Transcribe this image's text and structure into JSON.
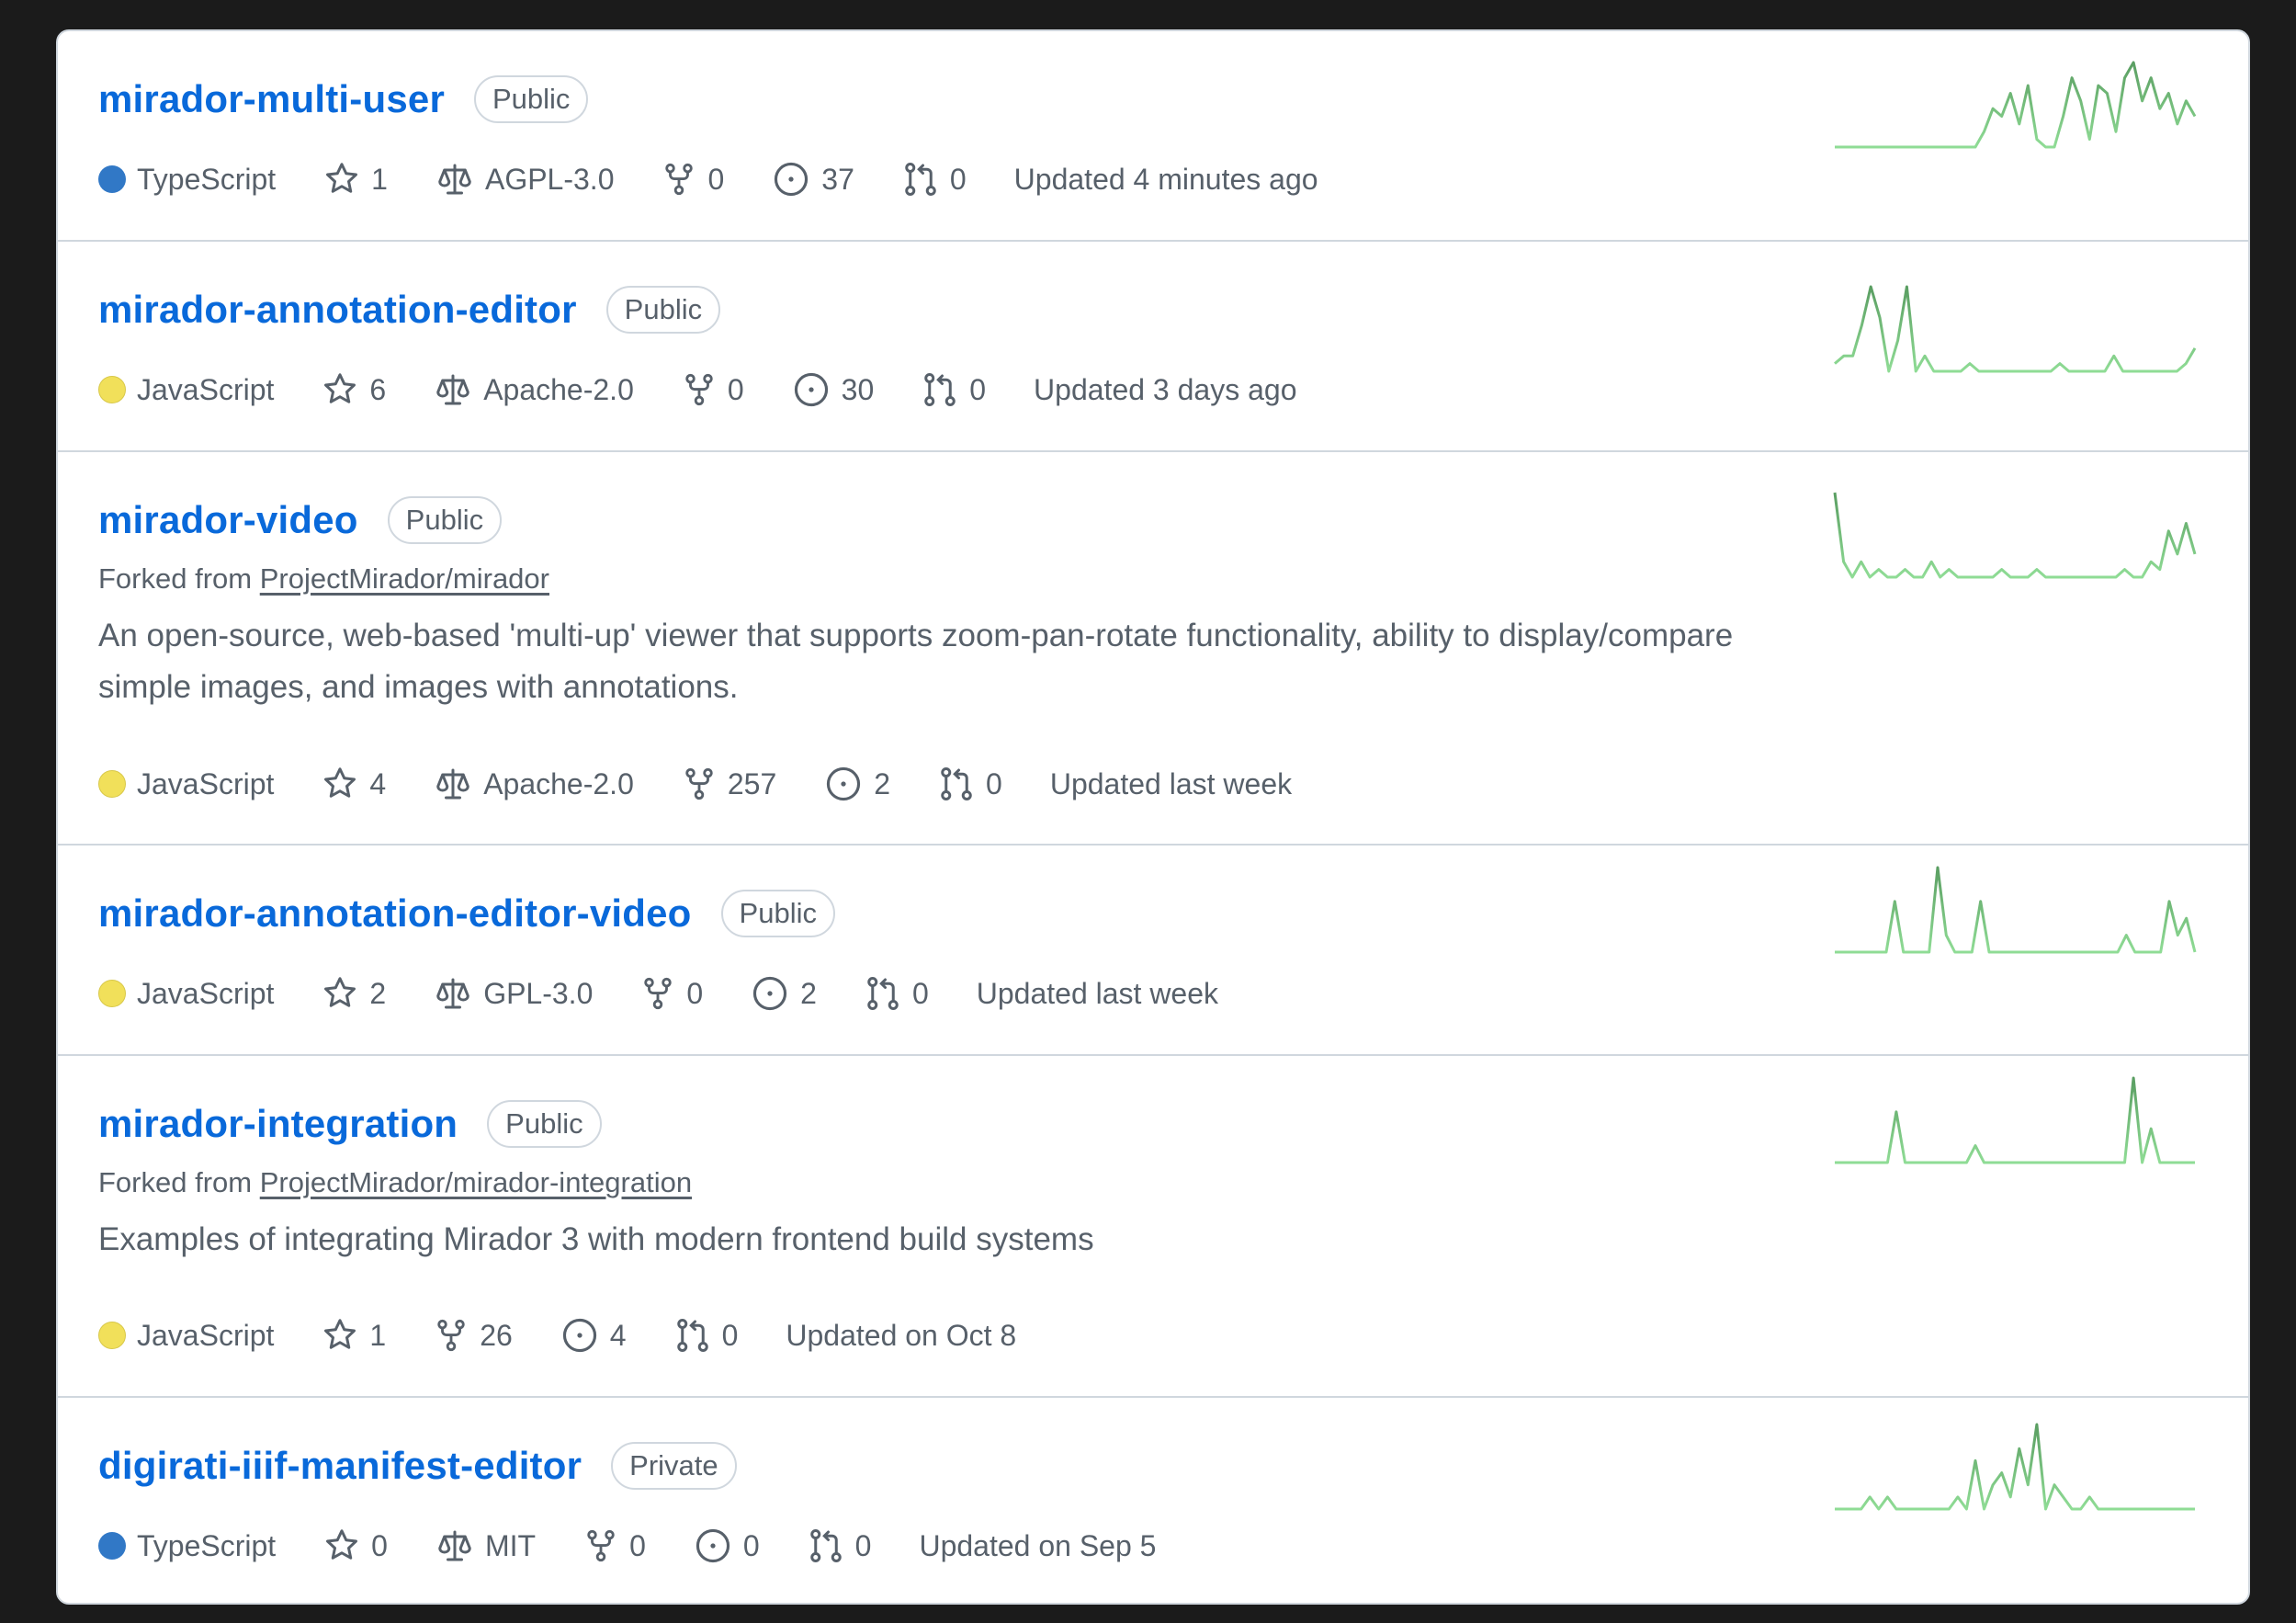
{
  "colors": {
    "link": "#0969da",
    "muted": "#57606a",
    "border": "#d0d7de",
    "typescript": "#3178c6",
    "javascript": "#f1e05a",
    "spark_light": "#8fdc95",
    "spark_dark": "#5a9e62"
  },
  "icons": [
    "star-icon",
    "law-icon",
    "fork-icon",
    "issue-icon",
    "pull-request-icon"
  ],
  "repos": [
    {
      "name": "mirador-multi-user",
      "visibility": "Public",
      "language": "TypeScript",
      "stars": "1",
      "license": "AGPL-3.0",
      "forks": "0",
      "issues": "37",
      "pulls": "0",
      "updated": "Updated 4 minutes ago",
      "activity": [
        0,
        0,
        0,
        0,
        0,
        0,
        0,
        0,
        0,
        0,
        0,
        0,
        0,
        0,
        0,
        0,
        0,
        2,
        5,
        4,
        7,
        3,
        8,
        1,
        0,
        0,
        4,
        9,
        6,
        1,
        8,
        7,
        2,
        9,
        11,
        6,
        9,
        5,
        7,
        3,
        6,
        4
      ]
    },
    {
      "name": "mirador-annotation-editor",
      "visibility": "Public",
      "language": "JavaScript",
      "stars": "6",
      "license": "Apache-2.0",
      "forks": "0",
      "issues": "30",
      "pulls": "0",
      "updated": "Updated 3 days ago",
      "activity": [
        1,
        2,
        2,
        6,
        11,
        7,
        0,
        4,
        11,
        0,
        2,
        0,
        0,
        0,
        0,
        1,
        0,
        0,
        0,
        0,
        0,
        0,
        0,
        0,
        0,
        1,
        0,
        0,
        0,
        0,
        0,
        2,
        0,
        0,
        0,
        0,
        0,
        0,
        0,
        1,
        3
      ]
    },
    {
      "name": "mirador-video",
      "visibility": "Public",
      "forked_prefix": "Forked from",
      "forked_from": "ProjectMirador/mirador",
      "description": "An open-source, web-based 'multi-up' viewer that supports zoom-pan-rotate functionality, ability to display/compare simple images, and images with annotations.",
      "language": "JavaScript",
      "stars": "4",
      "license": "Apache-2.0",
      "forks": "257",
      "issues": "2",
      "pulls": "0",
      "updated": "Updated last week",
      "activity": [
        11,
        2,
        0,
        2,
        0,
        1,
        0,
        0,
        1,
        0,
        0,
        2,
        0,
        1,
        0,
        0,
        0,
        0,
        0,
        1,
        0,
        0,
        0,
        1,
        0,
        0,
        0,
        0,
        0,
        0,
        0,
        0,
        0,
        1,
        0,
        0,
        2,
        1,
        6,
        3,
        7,
        3
      ]
    },
    {
      "name": "mirador-annotation-editor-video",
      "visibility": "Public",
      "language": "JavaScript",
      "stars": "2",
      "license": "GPL-3.0",
      "forks": "0",
      "issues": "2",
      "pulls": "0",
      "updated": "Updated last week",
      "activity": [
        0,
        0,
        0,
        0,
        0,
        0,
        0,
        3,
        0,
        0,
        0,
        0,
        5,
        1,
        0,
        0,
        0,
        3,
        0,
        0,
        0,
        0,
        0,
        0,
        0,
        0,
        0,
        0,
        0,
        0,
        0,
        0,
        0,
        0,
        1,
        0,
        0,
        0,
        0,
        3,
        1,
        2,
        0
      ]
    },
    {
      "name": "mirador-integration",
      "visibility": "Public",
      "forked_prefix": "Forked from",
      "forked_from": "ProjectMirador/mirador-integration",
      "description": "Examples of integrating Mirador 3 with modern frontend build systems",
      "language": "JavaScript",
      "stars": "1",
      "forks": "26",
      "issues": "4",
      "pulls": "0",
      "updated": "Updated on Oct 8",
      "activity": [
        0,
        0,
        0,
        0,
        0,
        0,
        0,
        3,
        0,
        0,
        0,
        0,
        0,
        0,
        0,
        0,
        1,
        0,
        0,
        0,
        0,
        0,
        0,
        0,
        0,
        0,
        0,
        0,
        0,
        0,
        0,
        0,
        0,
        0,
        5,
        0,
        2,
        0,
        0,
        0,
        0,
        0
      ]
    },
    {
      "name": "digirati-iiif-manifest-editor",
      "visibility": "Private",
      "language": "TypeScript",
      "stars": "0",
      "license": "MIT",
      "forks": "0",
      "issues": "0",
      "pulls": "0",
      "updated": "Updated on Sep 5",
      "activity": [
        0,
        0,
        0,
        0,
        1,
        0,
        1,
        0,
        0,
        0,
        0,
        0,
        0,
        0,
        1,
        0,
        4,
        0,
        2,
        3,
        1,
        5,
        2,
        7,
        0,
        2,
        1,
        0,
        0,
        1,
        0,
        0,
        0,
        0,
        0,
        0,
        0,
        0,
        0,
        0,
        0,
        0
      ]
    }
  ]
}
